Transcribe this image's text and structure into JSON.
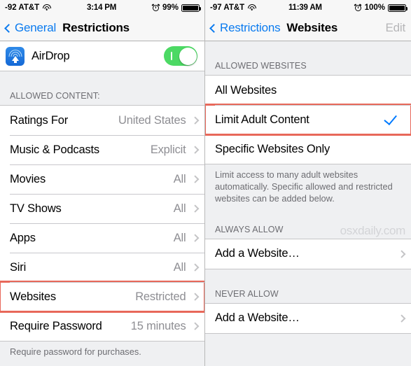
{
  "left": {
    "statusbar": {
      "signal": "-92 AT&T",
      "wifi_icon": "wifi-icon",
      "time": "3:14 PM",
      "alarm_icon": "alarm-clock-icon",
      "battery_pct": "99%",
      "battery_icon": "battery-icon"
    },
    "nav": {
      "back_label": "General",
      "title": "Restrictions"
    },
    "airdrop": {
      "icon": "airdrop-icon",
      "label": "AirDrop",
      "toggle_on": true,
      "toggle_color": "#4cd964"
    },
    "section_header": "ALLOWED CONTENT:",
    "rows": [
      {
        "label": "Ratings For",
        "value": "United States"
      },
      {
        "label": "Music & Podcasts",
        "value": "Explicit"
      },
      {
        "label": "Movies",
        "value": "All"
      },
      {
        "label": "TV Shows",
        "value": "All"
      },
      {
        "label": "Apps",
        "value": "All"
      },
      {
        "label": "Siri",
        "value": "All"
      },
      {
        "label": "Websites",
        "value": "Restricted",
        "highlighted": true
      },
      {
        "label": "Require Password",
        "value": "15 minutes"
      }
    ],
    "footer_note": "Require password for purchases."
  },
  "right": {
    "statusbar": {
      "signal": "-97 AT&T",
      "wifi_icon": "wifi-icon",
      "time": "11:39 AM",
      "alarm_icon": "alarm-clock-icon",
      "battery_pct": "100%",
      "battery_icon": "battery-icon"
    },
    "nav": {
      "back_label": "Restrictions",
      "title": "Websites",
      "edit_label": "Edit"
    },
    "section_header": "ALLOWED WEBSITES",
    "options": [
      {
        "label": "All Websites",
        "checked": false
      },
      {
        "label": "Limit Adult Content",
        "checked": true,
        "highlighted": true
      },
      {
        "label": "Specific Websites Only",
        "checked": false
      }
    ],
    "footer_note": "Limit access to many adult websites automatically. Specific allowed and restricted websites can be added below.",
    "always_allow": {
      "header": "ALWAYS ALLOW",
      "row_label": "Add a Website…"
    },
    "never_allow": {
      "header": "NEVER ALLOW",
      "row_label": "Add a Website…"
    },
    "watermark": "osxdaily.com"
  },
  "colors": {
    "accent_blue": "#007aff",
    "nav_blue": "#0b7bef",
    "toggle_green": "#4cd964",
    "highlight_red": "#e8685a",
    "gray_text": "#8e8e93"
  }
}
